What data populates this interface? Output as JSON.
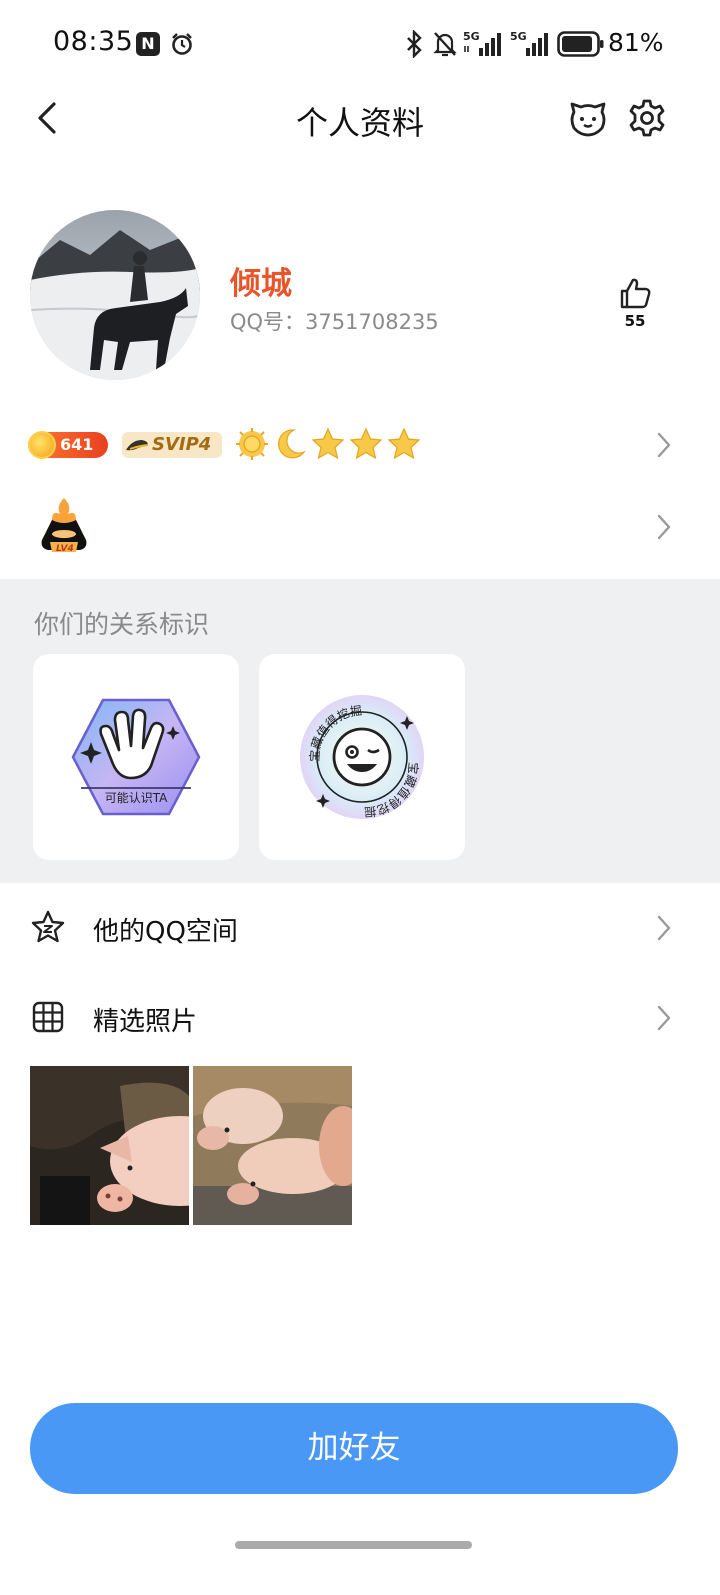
{
  "status_bar": {
    "time": "08:35",
    "nfc_icon": "N",
    "signal_1_label": "5G",
    "signal_2_label": "5G",
    "battery": "81%"
  },
  "nav": {
    "title": "个人资料"
  },
  "profile": {
    "nickname": "倾城",
    "qq_number": "QQ号：3751708235",
    "like_count": "55"
  },
  "badges": {
    "coin_value": "641",
    "svip_label": "SVIP4"
  },
  "relationship": {
    "title": "你们的关系标识",
    "badge_1_text": "可能认识TA",
    "badge_2_text": "宝藏值得挖掘"
  },
  "list": {
    "qzone_label": "他的QQ空间",
    "photos_label": "精选照片"
  },
  "actions": {
    "add_friend_label": "加好友"
  },
  "colors": {
    "nickname": "#e8552b",
    "button": "#4a98f5",
    "section_bg": "#eff0f2"
  },
  "icons": {
    "back": "back-icon",
    "pet": "pet-icon",
    "settings": "gear-icon",
    "like": "thumbs-up-icon",
    "qzone": "star-icon",
    "photos": "grid-icon"
  }
}
